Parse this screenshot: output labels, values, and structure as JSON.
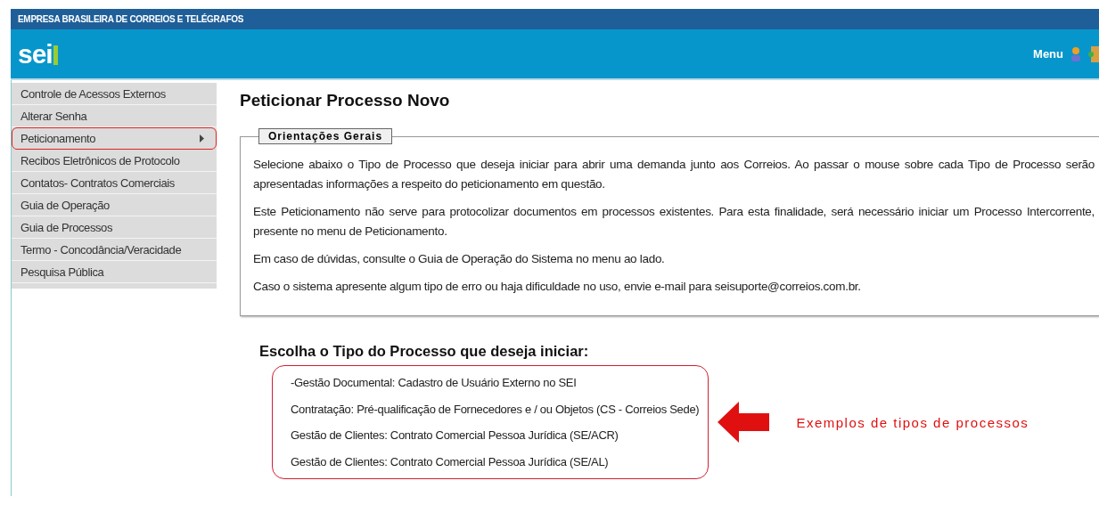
{
  "top_bar": {
    "title": "EMPRESA BRASILEIRA DE CORREIOS E TELÉGRAFOS"
  },
  "header": {
    "logo": "sei",
    "menu": "Menu"
  },
  "sidebar": {
    "items": [
      {
        "label": "Controle de Acessos Externos",
        "has_submenu": false,
        "annotated": false
      },
      {
        "label": "Alterar Senha",
        "has_submenu": false,
        "annotated": false
      },
      {
        "label": "Peticionamento",
        "has_submenu": true,
        "annotated": true
      },
      {
        "label": "Recibos Eletrônicos de Protocolo",
        "has_submenu": false,
        "annotated": false
      },
      {
        "label": "Contatos- Contratos Comerciais",
        "has_submenu": false,
        "annotated": false
      },
      {
        "label": "Guia de Operação",
        "has_submenu": false,
        "annotated": false
      },
      {
        "label": "Guia de Processos",
        "has_submenu": false,
        "annotated": false
      },
      {
        "label": "Termo - Concodância/Veracidade",
        "has_submenu": false,
        "annotated": false
      },
      {
        "label": "Pesquisa Pública",
        "has_submenu": false,
        "annotated": false
      }
    ]
  },
  "page_title": "Peticionar Processo Novo",
  "guidelines": {
    "legend": "Orientações Gerais",
    "paragraphs": [
      "Selecione abaixo o Tipo de Processo que deseja iniciar para abrir uma demanda junto aos Correios. Ao passar o mouse sobre cada Tipo de Processo serão apresentadas informações a respeito do peticionamento em questão.",
      "Este Peticionamento não serve para protocolizar documentos em processos existentes. Para esta finalidade, será necessário iniciar um Processo Intercorrente, presente no menu de Peticionamento.",
      "Em caso de dúvidas, consulte o Guia de Operação do Sistema no menu ao lado.",
      "Caso o sistema apresente algum tipo de erro ou haja dificuldade no uso, envie e-mail para seisuporte@correios.com.br."
    ]
  },
  "process_types": {
    "heading": "Escolha o Tipo do Processo que deseja iniciar:",
    "items": [
      "-Gestão Documental: Cadastro de Usuário Externo no SEI",
      "Contratação: Pré-qualificação de Fornecedores e / ou Objetos (CS - Correios Sede)",
      "Gestão de Clientes: Contrato Comercial Pessoa Jurídica (SE/ACR)",
      "Gestão de Clientes: Contrato Comercial Pessoa Jurídica (SE/AL)"
    ],
    "annotation": "Exemplos de tipos de processos"
  }
}
